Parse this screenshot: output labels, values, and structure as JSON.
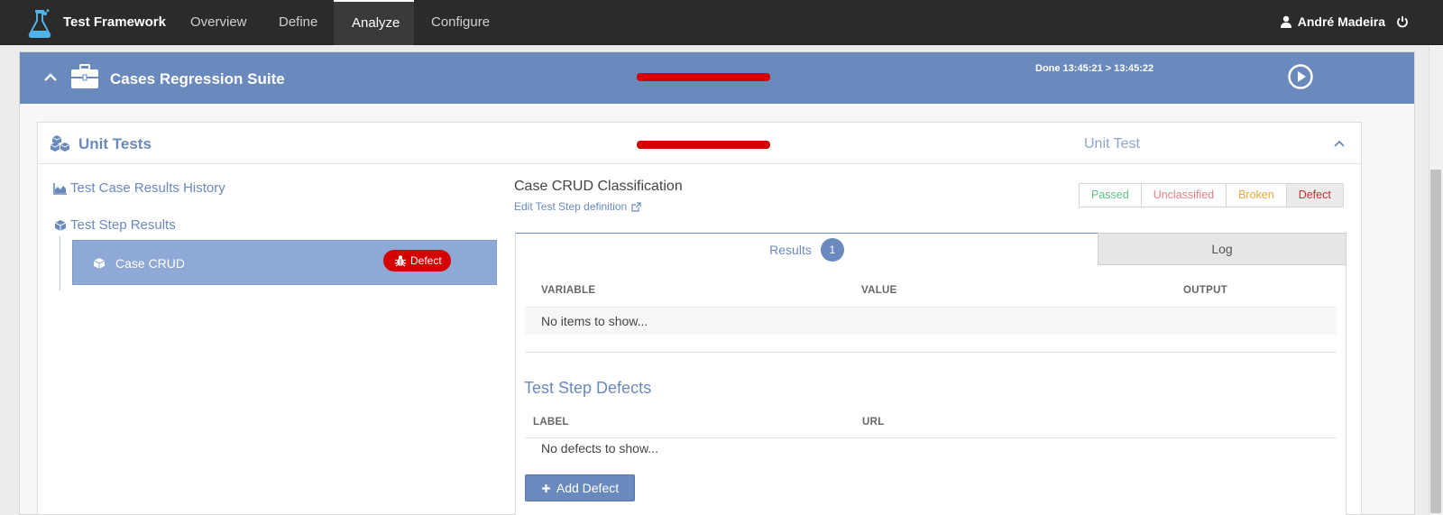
{
  "navbar": {
    "brand": "Test Framework",
    "tabs": [
      {
        "label": "Overview"
      },
      {
        "label": "Define"
      },
      {
        "label": "Analyze",
        "active": true
      },
      {
        "label": "Configure"
      }
    ],
    "user_name": "André Madeira"
  },
  "suite": {
    "title": "Cases Regression Suite",
    "status": "Done 13:45:21 > 13:45:22"
  },
  "unit": {
    "title": "Unit Tests",
    "type": "Unit Test"
  },
  "left": {
    "history_link": "Test Case Results History",
    "step_results_label": "Test Step Results",
    "step_item": {
      "label": "Case CRUD",
      "badge": "Defect"
    }
  },
  "detail": {
    "title": "Case CRUD Classification",
    "edit_link": "Edit Test Step definition",
    "classifications": [
      {
        "label": "Passed"
      },
      {
        "label": "Unclassified"
      },
      {
        "label": "Broken"
      },
      {
        "label": "Defect",
        "selected": true
      }
    ],
    "tabs": {
      "results_label": "Results",
      "results_count": "1",
      "log_label": "Log"
    },
    "results_table": {
      "headers": [
        "VARIABLE",
        "VALUE",
        "OUTPUT"
      ],
      "empty_text": "No items to show..."
    },
    "defects": {
      "title": "Test Step Defects",
      "headers": [
        "LABEL",
        "URL"
      ],
      "empty_text": "No defects to show...",
      "add_button": "Add Defect"
    }
  },
  "colors": {
    "navbar_bg": "#2b2b2b",
    "accent": "#6a89bd",
    "selected_item": "#8fa9d6",
    "defect_red": "#d40000",
    "passed_green": "#5cc383",
    "unclassified_pink": "#e37e87",
    "broken_orange": "#f0a53a"
  }
}
